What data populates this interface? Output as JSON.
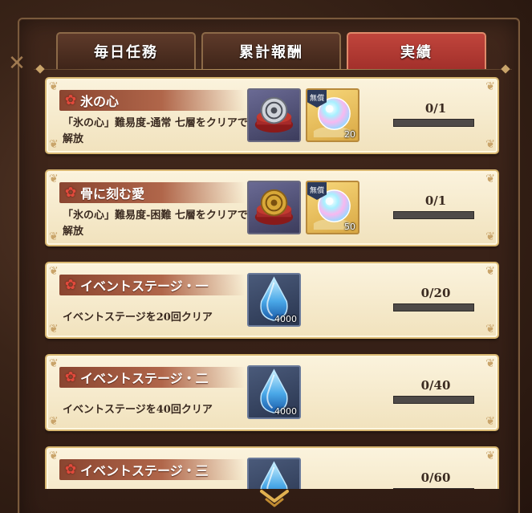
{
  "tabs": [
    {
      "label": "毎日任務",
      "active": false
    },
    {
      "label": "累計報酬",
      "active": false
    },
    {
      "label": "実績",
      "active": true
    }
  ],
  "badge_label": "無償",
  "achievements": [
    {
      "title": "氷の心",
      "description": "「氷の心」難易度-通常 七層をクリアで解放",
      "rewards": [
        {
          "icon": "white-crest-item",
          "quantity": ""
        },
        {
          "icon": "rainbow-gem",
          "quantity": "20",
          "badge": true
        }
      ],
      "progress_text": "0/1",
      "progress_fraction": 0
    },
    {
      "title": "骨に刻む愛",
      "description": "「氷の心」難易度-困難 七層をクリアで解放",
      "rewards": [
        {
          "icon": "gold-crest-item",
          "quantity": ""
        },
        {
          "icon": "rainbow-gem",
          "quantity": "50",
          "badge": true
        }
      ],
      "progress_text": "0/1",
      "progress_fraction": 0
    },
    {
      "title": "イベントステージ・一",
      "description": "イベントステージを20回クリア",
      "rewards": [
        {
          "icon": "blue-droplet",
          "quantity": "4000"
        }
      ],
      "progress_text": "0/20",
      "progress_fraction": 0
    },
    {
      "title": "イベントステージ・二",
      "description": "イベントステージを40回クリア",
      "rewards": [
        {
          "icon": "blue-droplet",
          "quantity": "4000"
        }
      ],
      "progress_text": "0/40",
      "progress_fraction": 0
    },
    {
      "title": "イベントステージ・三",
      "description": "",
      "rewards": [
        {
          "icon": "blue-droplet",
          "quantity": ""
        }
      ],
      "progress_text": "0/60",
      "progress_fraction": 0
    }
  ],
  "colors": {
    "active_tab": "#b33a32",
    "card_bg": "#f6ebcd",
    "title_bar": "#9a5038",
    "progress_track": "#4e4a48"
  }
}
